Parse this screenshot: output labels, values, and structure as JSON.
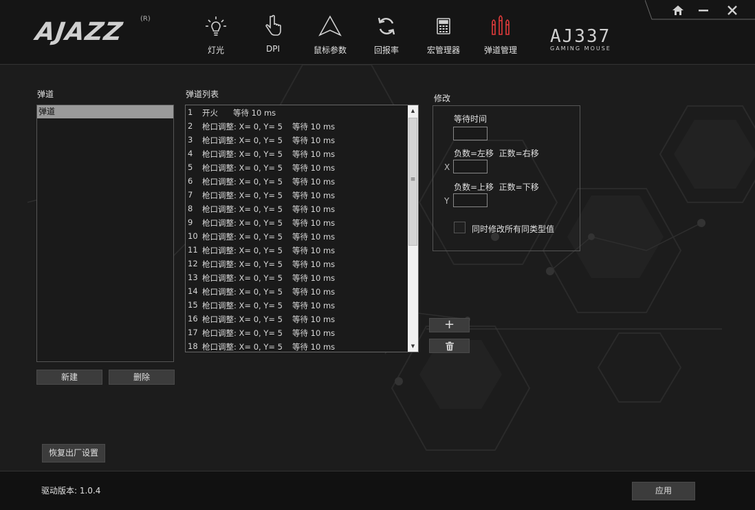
{
  "header": {
    "logo": "AJAZZ",
    "logo_mark": "R",
    "model_name": "AJ337",
    "model_sub": "GAMING MOUSE",
    "nav": [
      {
        "label": "灯光",
        "icon": "bulb-icon"
      },
      {
        "label": "DPI",
        "icon": "pointer-hand-icon"
      },
      {
        "label": "鼠标参数",
        "icon": "triangle-icon"
      },
      {
        "label": "回报率",
        "icon": "refresh-icon"
      },
      {
        "label": "宏管理器",
        "icon": "calculator-icon"
      },
      {
        "label": "弹道管理",
        "icon": "bullets-icon"
      }
    ],
    "active_color": "#e23b3b"
  },
  "trail": {
    "title": "弹道",
    "items": [
      "弹道"
    ],
    "new_label": "新建",
    "delete_label": "删除"
  },
  "sequence": {
    "title": "弹道列表",
    "rows": [
      {
        "num": "1",
        "action": "开火",
        "wait": "等待 10 ms"
      },
      {
        "num": "2",
        "action": "枪口调整: X= 0, Y= 5",
        "wait": "等待 10 ms"
      },
      {
        "num": "3",
        "action": "枪口调整: X= 0, Y= 5",
        "wait": "等待 10 ms"
      },
      {
        "num": "4",
        "action": "枪口调整: X= 0, Y= 5",
        "wait": "等待 10 ms"
      },
      {
        "num": "5",
        "action": "枪口调整: X= 0, Y= 5",
        "wait": "等待 10 ms"
      },
      {
        "num": "6",
        "action": "枪口调整: X= 0, Y= 5",
        "wait": "等待 10 ms"
      },
      {
        "num": "7",
        "action": "枪口调整: X= 0, Y= 5",
        "wait": "等待 10 ms"
      },
      {
        "num": "8",
        "action": "枪口调整: X= 0, Y= 5",
        "wait": "等待 10 ms"
      },
      {
        "num": "9",
        "action": "枪口调整: X= 0, Y= 5",
        "wait": "等待 10 ms"
      },
      {
        "num": "10",
        "action": "枪口调整: X= 0, Y= 5",
        "wait": "等待 10 ms"
      },
      {
        "num": "11",
        "action": "枪口调整: X= 0, Y= 5",
        "wait": "等待 10 ms"
      },
      {
        "num": "12",
        "action": "枪口调整: X= 0, Y= 5",
        "wait": "等待 10 ms"
      },
      {
        "num": "13",
        "action": "枪口调整: X= 0, Y= 5",
        "wait": "等待 10 ms"
      },
      {
        "num": "14",
        "action": "枪口调整: X= 0, Y= 5",
        "wait": "等待 10 ms"
      },
      {
        "num": "15",
        "action": "枪口调整: X= 0, Y= 5",
        "wait": "等待 10 ms"
      },
      {
        "num": "16",
        "action": "枪口调整: X= 0, Y= 5",
        "wait": "等待 10 ms"
      },
      {
        "num": "17",
        "action": "枪口调整: X= 0, Y= 5",
        "wait": "等待 10 ms"
      },
      {
        "num": "18",
        "action": "枪口调整: X= 0, Y= 5",
        "wait": "等待 10 ms"
      }
    ],
    "add_symbol": "+",
    "scroll_up": "▲",
    "scroll_down": "▼",
    "scroll_grip": "≡"
  },
  "edit": {
    "title": "修改",
    "wait_label": "等待时间",
    "wait_value": "",
    "x_hint": "负数=左移  正数=右移",
    "x_label": "X",
    "x_value": "",
    "y_hint": "负数=上移  正数=下移",
    "y_label": "Y",
    "y_value": "",
    "sync_label": "同时修改所有同类型值"
  },
  "footer": {
    "reset_label": "恢复出厂设置",
    "version": "驱动版本: 1.0.4",
    "apply_label": "应用"
  }
}
